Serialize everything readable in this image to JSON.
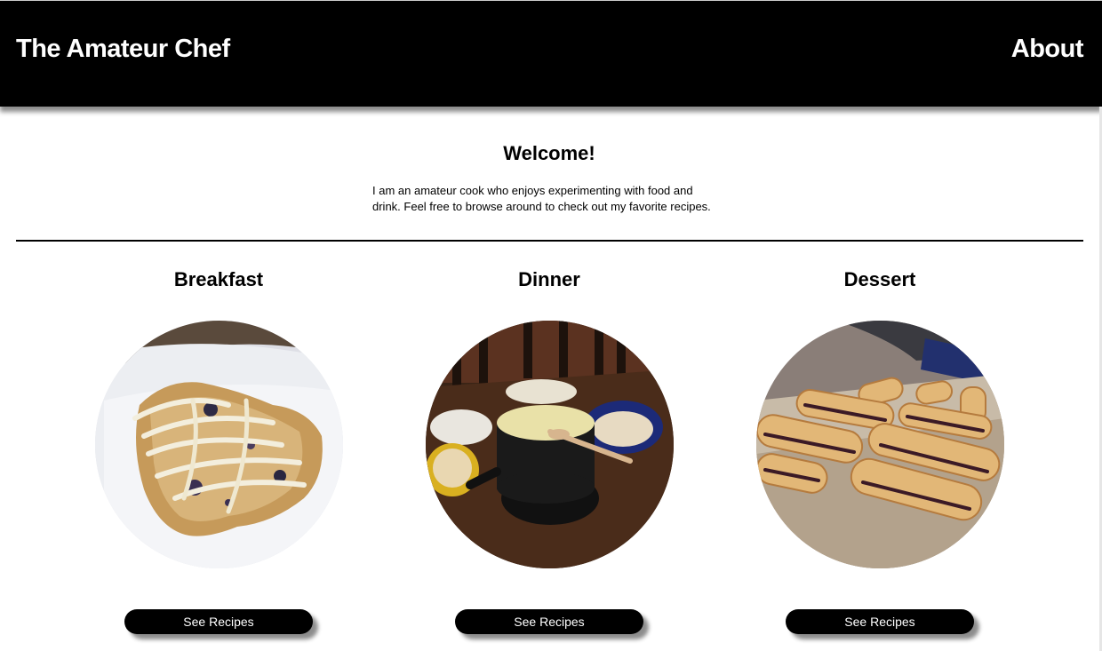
{
  "header": {
    "brand": "The Amateur Chef",
    "nav_about": "About"
  },
  "intro": {
    "title": "Welcome!",
    "text": "I am an amateur cook who enjoys experimenting with food and drink. Feel free to browse around to check out my favorite recipes."
  },
  "categories": [
    {
      "title": "Breakfast",
      "button": "See Recipes",
      "photo": "blueberry-scone-photo"
    },
    {
      "title": "Dinner",
      "button": "See Recipes",
      "photo": "cheese-fondue-photo"
    },
    {
      "title": "Dessert",
      "button": "See Recipes",
      "photo": "filled-pastries-photo"
    }
  ],
  "colors": {
    "header_bg": "#000000",
    "button_bg": "#000000",
    "page_bg": "#ffffff"
  }
}
